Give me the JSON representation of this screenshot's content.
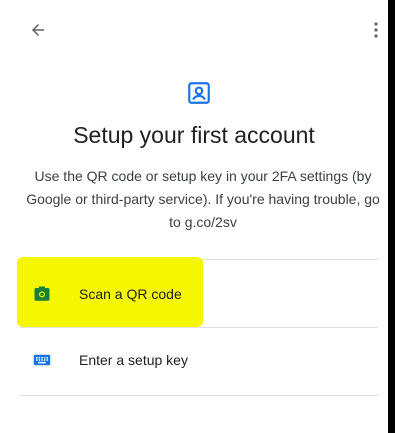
{
  "header": {
    "back_icon": "arrow-back-icon",
    "more_icon": "more-vert-icon"
  },
  "hero": {
    "icon": "account-box-icon",
    "title": "Setup your first account",
    "description": "Use the QR code or setup key in your 2FA settings (by Google or third-party service). If you're having trouble, go to g.co/2sv"
  },
  "options": [
    {
      "label": "Scan a QR code",
      "icon": "camera-icon",
      "highlighted": true
    },
    {
      "label": "Enter a setup key",
      "icon": "keyboard-icon",
      "highlighted": false
    }
  ],
  "colors": {
    "accent": "#1a73e8",
    "camera_icon": "#188038",
    "highlight": "#f4f700",
    "background_outside": "#000000"
  }
}
